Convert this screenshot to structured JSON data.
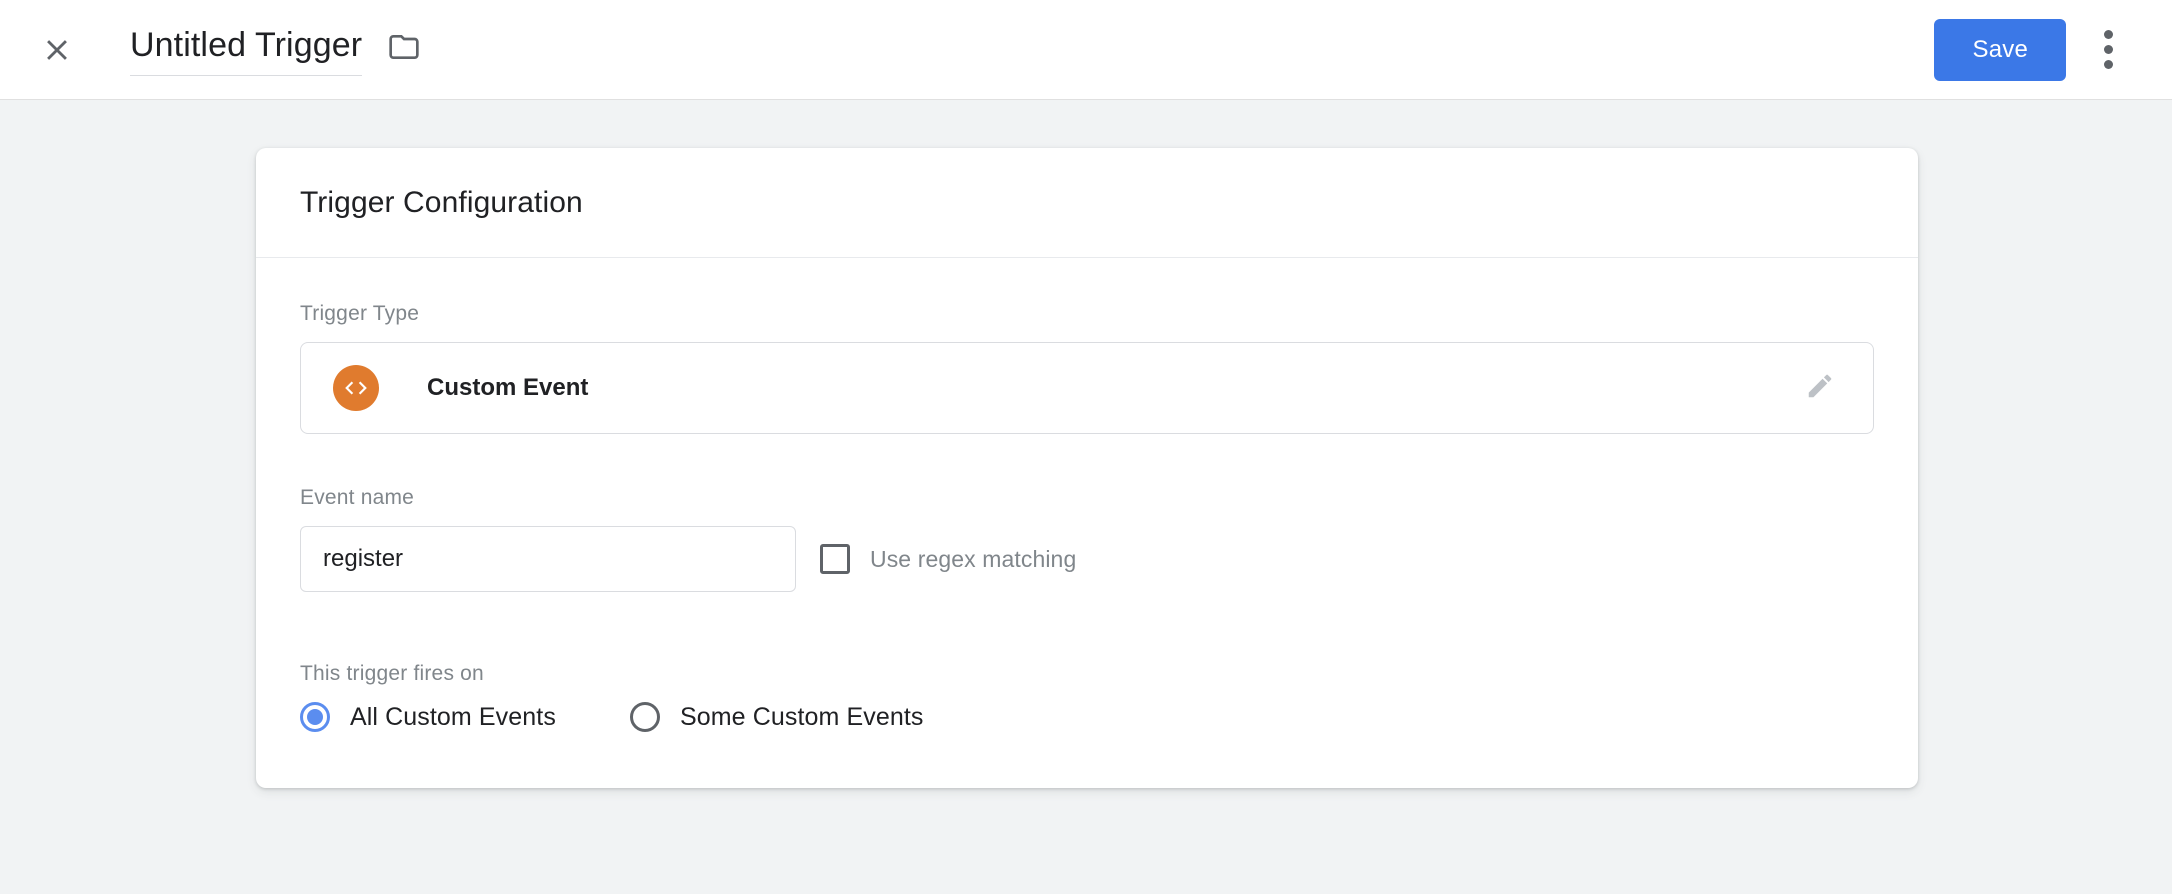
{
  "header": {
    "close_icon": "close-icon",
    "title": "Untitled Trigger",
    "folder_icon": "folder-icon",
    "save_label": "Save",
    "overflow_icon": "more-vert-icon"
  },
  "card": {
    "title": "Trigger Configuration",
    "trigger_type": {
      "label": "Trigger Type",
      "icon": "code-brackets-icon",
      "name": "Custom Event",
      "edit_icon": "pencil-edit-icon"
    },
    "event_name": {
      "label": "Event name",
      "value": "register",
      "placeholder": "",
      "regex_label": "Use regex matching",
      "regex_checked": false
    },
    "fires_on": {
      "label": "This trigger fires on",
      "options": [
        {
          "label": "All Custom Events",
          "selected": true
        },
        {
          "label": "Some Custom Events",
          "selected": false
        }
      ]
    }
  },
  "colors": {
    "accent_blue": "#3B78E7",
    "radio_blue": "#5B8DEF",
    "custom_event_orange": "#E07B2E",
    "page_background": "#F1F3F4",
    "text_primary": "#202124",
    "text_secondary": "#80868B"
  }
}
